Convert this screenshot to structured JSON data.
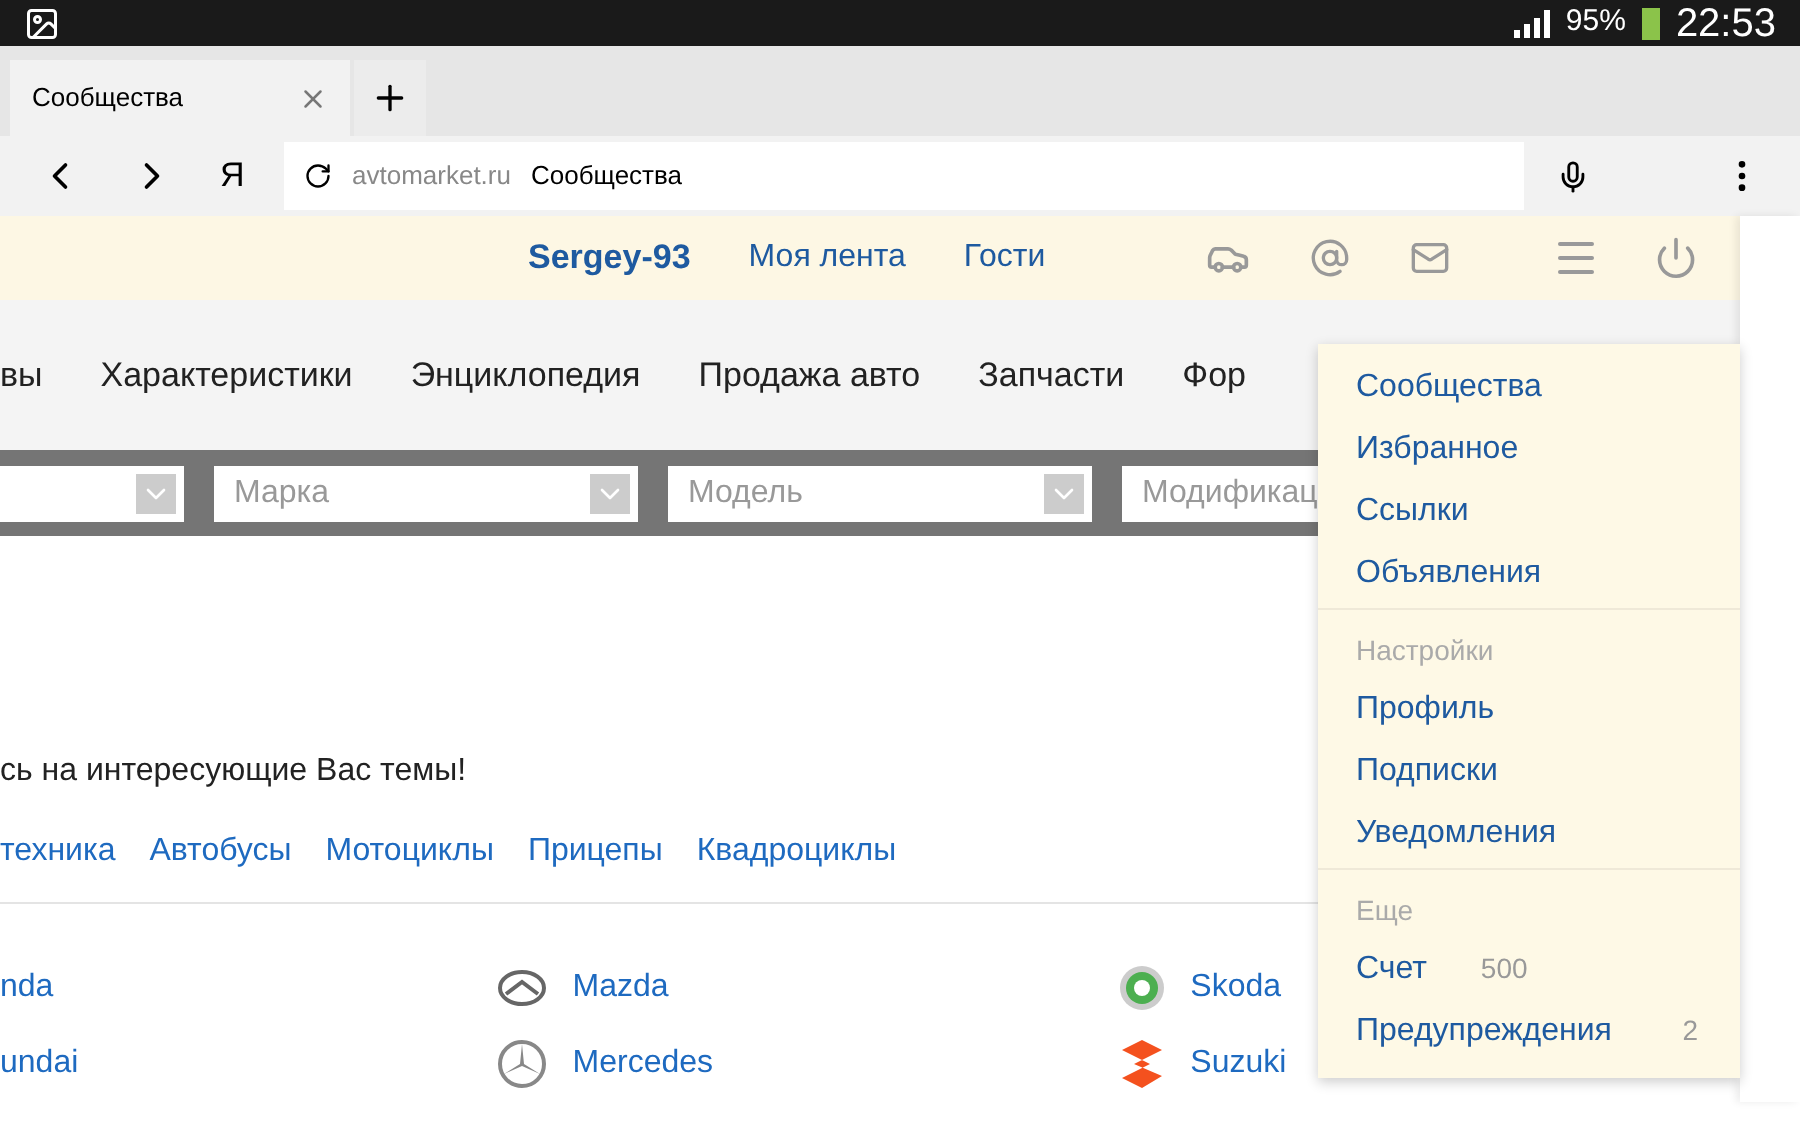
{
  "status_bar": {
    "battery": "95%",
    "time": "22:53"
  },
  "tabs": [
    {
      "label": "Сообщества",
      "selected": true
    }
  ],
  "toolbar": {
    "yandex": "Я",
    "url_domain": "avtomarket.ru",
    "url_title": "Сообщества"
  },
  "header": {
    "user": "Sergey-93",
    "links": [
      "Моя лента",
      "Гости"
    ]
  },
  "nav": [
    "вы",
    "Характеристики",
    "Энциклопедия",
    "Продажа авто",
    "Запчасти",
    "Фор"
  ],
  "filters": [
    {
      "kind": "blank"
    },
    {
      "kind": "select",
      "placeholder": "Марка"
    },
    {
      "kind": "select",
      "placeholder": "Модель"
    },
    {
      "kind": "cut",
      "placeholder": "Модификац"
    }
  ],
  "intro": "сь на интересующие Вас темы!",
  "categories": [
    "техника",
    "Автобусы",
    "Мотоциклы",
    "Прицепы",
    "Квадроциклы"
  ],
  "brands": [
    [
      {
        "name": "nda",
        "kind": "none"
      },
      {
        "name": "Mazda",
        "kind": "mazda"
      },
      {
        "name": "Skoda",
        "kind": "skoda"
      }
    ],
    [
      {
        "name": "undai",
        "kind": "none"
      },
      {
        "name": "Mercedes",
        "kind": "mercedes"
      },
      {
        "name": "Suzuki",
        "kind": "suzuki"
      }
    ]
  ],
  "menu": {
    "sections": [
      {
        "items": [
          {
            "label": "Сообщества"
          },
          {
            "label": "Избранное"
          },
          {
            "label": "Ссылки"
          },
          {
            "label": "Объявления"
          }
        ]
      },
      {
        "title": "Настройки",
        "items": [
          {
            "label": "Профиль"
          },
          {
            "label": "Подписки"
          },
          {
            "label": "Уведомления"
          }
        ]
      },
      {
        "title": "Еще",
        "items": [
          {
            "label": "Счет",
            "count": "500"
          },
          {
            "label": "Предупреждения",
            "count": "2"
          }
        ]
      }
    ]
  }
}
